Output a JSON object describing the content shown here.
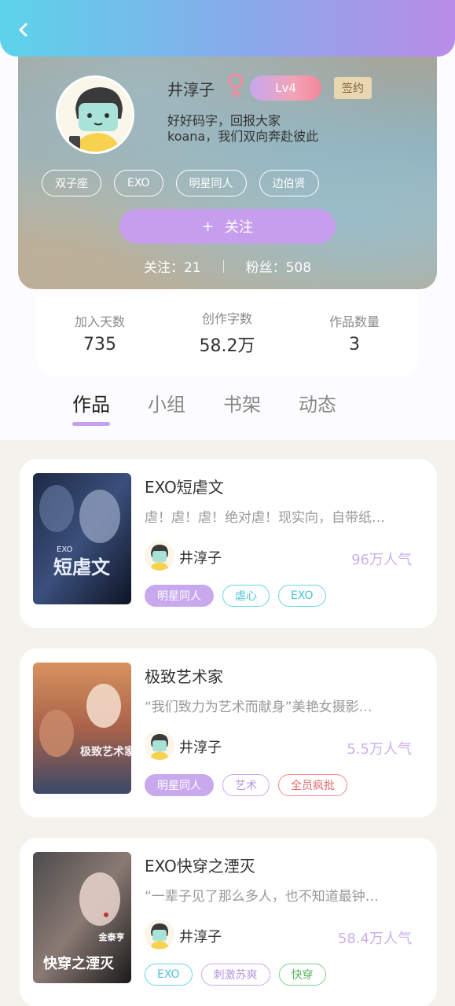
{
  "profile": {
    "username": "井淳子",
    "level": "Lv4",
    "sign_label": "签约",
    "bio_line1": "好好码字，回报大家",
    "bio_line2": "koana，我们双向奔赴彼此",
    "tags": [
      "双子座",
      "EXO",
      "明星同人",
      "边伯贤"
    ],
    "follow_button": "关注",
    "follow_plus": "+",
    "following_label": "关注：21",
    "fans_label": "粉丝：508"
  },
  "stats": [
    {
      "label": "加入天数",
      "value": "735"
    },
    {
      "label": "创作字数",
      "value": "58.2万"
    },
    {
      "label": "作品数量",
      "value": "3"
    }
  ],
  "tabs": [
    "作品",
    "小组",
    "书架",
    "动态"
  ],
  "works": [
    {
      "title": "EXO短虐文",
      "desc": "虐！虐！虐！绝对虐！现实向，自带纸…",
      "author": "井淳子",
      "popularity": "96万人气",
      "tags": [
        "明星同人",
        "虐心",
        "EXO"
      ],
      "cover_text": "短虐文",
      "cover_sub": "EXO"
    },
    {
      "title": "极致艺术家",
      "desc": "“我们致力为艺术而献身”美艳女摄影…",
      "author": "井淳子",
      "popularity": "5.5万人气",
      "tags": [
        "明星同人",
        "艺术",
        "全员疯批"
      ],
      "cover_text": "极致艺术家"
    },
    {
      "title": "EXO快穿之湮灭",
      "desc": "“一辈子见了那么多人，也不知道最钟…",
      "author": "井淳子",
      "popularity": "58.4万人气",
      "tags": [
        "EXO",
        "刺激苏爽",
        "快穿"
      ],
      "cover_text": "快穿之湮灭",
      "cover_sub": "金泰亨"
    }
  ],
  "colors": {
    "accent": "#c79ded",
    "topbar_start": "#5cd3ea",
    "topbar_end": "#b98ce8",
    "popularity": "#cbb0ec"
  }
}
